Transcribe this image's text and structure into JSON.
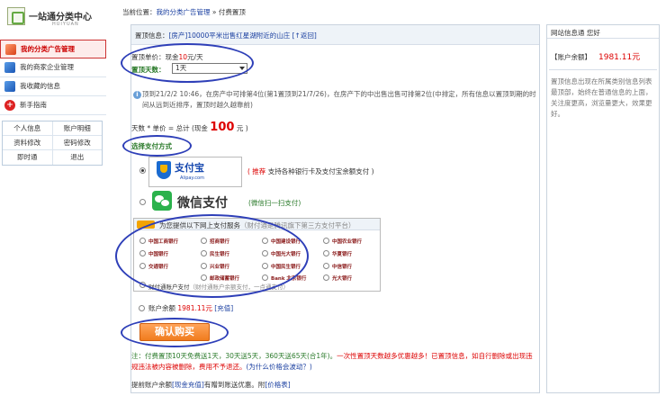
{
  "logo": {
    "title": "一站通分类中心",
    "subtitle": "HUIYUAN"
  },
  "sidebar": {
    "items": [
      {
        "label": "我的分类广告管理",
        "active": true
      },
      {
        "label": "我的商家企业管理",
        "active": false
      },
      {
        "label": "我收藏的信息",
        "active": false
      },
      {
        "label": "新手指南",
        "active": false
      }
    ],
    "grid": [
      [
        "个人信息",
        "账户明细"
      ],
      [
        "资料修改",
        "密码修改"
      ],
      [
        "即时通",
        "退出"
      ]
    ]
  },
  "breadcrumb": {
    "prefix": "当前位置：",
    "link": "我的分类广告管理",
    "sep": " » ",
    "current": "付费置顶"
  },
  "info": {
    "label": "置顶信息：",
    "title": "[房产]10000平米出售红星湖附近的山庄",
    "back": "[↑返回]"
  },
  "price": {
    "label": "置顶单价：现金",
    "value": "10",
    "unit": "元/天"
  },
  "days": {
    "label": "置顶天数：",
    "selected": "1天"
  },
  "notice": {
    "text": "顶到21/2/2 10:46，在房产中可排第4位(第1置顶到21/7/26)，在房产下的中出售出售可排第2位(中排定，所有信息以置顶到期的时间从远到近排序，置顶时越久越靠前)"
  },
  "total": {
    "text": "天数 * 单价 = 总计 (现金",
    "amount": "100",
    "unit": "元 )"
  },
  "payment": {
    "heading": "选择支付方式",
    "alipay": {
      "name": "支付宝",
      "url": "Alipay.com",
      "recommend": "( 推荐",
      "desc": "支持各种银行卡及支付宝余额支付 )"
    },
    "wechat": {
      "name": "微信支付",
      "desc": "(微信扫一扫支付)"
    },
    "bank": {
      "logo": "财付通",
      "title": "为您提供以下网上支付服务",
      "subtitle": "（财付通是腾讯旗下第三方支付平台）",
      "banks": [
        "中国工商银行",
        "招商银行",
        "中国建设银行",
        "中国农业银行",
        "中国银行",
        "民生银行",
        "光大银行",
        "中国光大银行",
        "华夏银行",
        "交通银行",
        "兴业银行",
        "中国民生银行",
        "中信银行",
        "邮政储蓄银行",
        "Bank 北京银行"
      ],
      "tenpay_label": "财付通账户支付",
      "tenpay_desc": "（财付通账户余额支付，一点通支付）"
    },
    "balance": {
      "label": "账户余额",
      "amount": "1981.11元",
      "recharge": "[充值]"
    }
  },
  "buy_button": "确认购买",
  "note": {
    "prefix": "注：付费置顶10天免费送1天，30天送5天，360天送65天(合1年)。",
    "warning": "一次性置顶天数越多优惠越多！已置顶信息，如自行删除或出现违规违法被内容被删除，费用不予退还。",
    "link": "(为什么价格会波动？)"
  },
  "bottom": {
    "text": "提前账户余额",
    "recharge": "[现金充值]",
    "mid": "有赠到账送优惠。附",
    "price": "[价格表]"
  },
  "right_panel": {
    "header": "网站信息通 您好",
    "balance_label": "【账户余额】",
    "balance": "1981.11元",
    "desc": "置顶信息出现在所属类别信息列表最顶部，始终在普通信息的上面，关注度更高，浏览量更大，效果更好。"
  },
  "colors": {
    "accent_red": "#dd0000",
    "link_blue": "#1a3fa0",
    "green": "#2a7a2a",
    "button_orange": "#f07c1e",
    "ellipse": "#2e3fb8"
  }
}
